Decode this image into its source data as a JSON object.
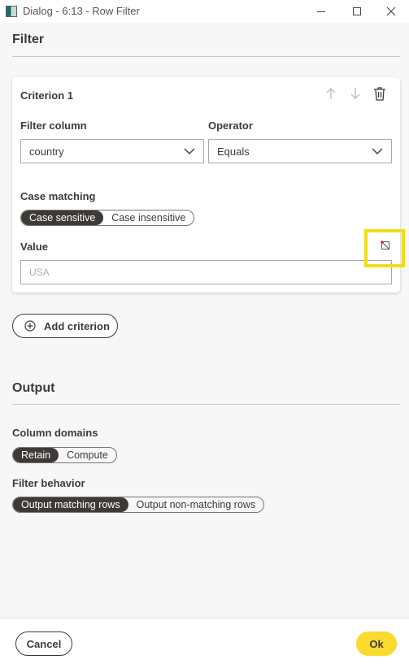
{
  "window": {
    "title": "Dialog - 6:13 - Row Filter"
  },
  "filter": {
    "title": "Filter",
    "criterion": {
      "title": "Criterion 1",
      "filter_column_label": "Filter column",
      "filter_column_value": "country",
      "operator_label": "Operator",
      "operator_value": "Equals",
      "case_label": "Case matching",
      "case_options": [
        "Case sensitive",
        "Case insensitive"
      ],
      "case_selected": "Case sensitive",
      "value_label": "Value",
      "value_placeholder": "USA"
    },
    "add_label": "Add criterion"
  },
  "output": {
    "title": "Output",
    "domains_label": "Column domains",
    "domains_options": [
      "Retain",
      "Compute"
    ],
    "domains_selected": "Retain",
    "behavior_label": "Filter behavior",
    "behavior_options": [
      "Output matching rows",
      "Output non-matching rows"
    ],
    "behavior_selected": "Output matching rows"
  },
  "footer": {
    "cancel_label": "Cancel",
    "ok_label": "Ok"
  },
  "colors": {
    "accent": "#fbda2e",
    "dark": "#3e3a39",
    "highlight": "#f0dd1a"
  }
}
